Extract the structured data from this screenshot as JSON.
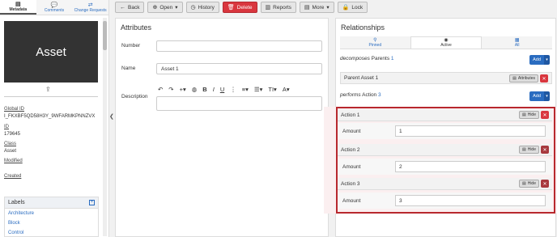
{
  "left": {
    "tabs": [
      {
        "label": "Metadata",
        "icon": "metadata-icon"
      },
      {
        "label": "Comments",
        "icon": "comments-icon"
      },
      {
        "label": "Change Requests",
        "icon": "change-requests-icon"
      }
    ],
    "asset_title": "Asset",
    "global_id_label": "Global ID",
    "global_id_value": "I_FKXBF5QD58H3Y_9WFARMKPNNZVX",
    "id_label": "ID",
    "id_value": "179645",
    "class_label": "Class",
    "class_value": "Asset",
    "modified_label": "Modified",
    "created_label": "Created",
    "labels_title": "Labels",
    "labels": [
      "Architecture",
      "Block",
      "Control"
    ]
  },
  "toolbar": {
    "back": "Back",
    "open": "Open",
    "history": "History",
    "delete": "Delete",
    "reports": "Reports",
    "more": "More",
    "lock": "Lock"
  },
  "attributes": {
    "title": "Attributes",
    "number_label": "Number",
    "number_value": "",
    "name_label": "Name",
    "name_value": "Asset 1",
    "description_label": "Description"
  },
  "relationships": {
    "title": "Relationships",
    "tabs": [
      {
        "label": "Pinned",
        "icon": "pin-icon"
      },
      {
        "label": "Active",
        "icon": "active-icon"
      },
      {
        "label": "All",
        "icon": "all-icon"
      }
    ],
    "group1": {
      "verb": "decomposes",
      "noun": "Parents",
      "count": "1",
      "add": "Add"
    },
    "parent_row": {
      "label": "Parent Asset 1",
      "btn": "Attributes"
    },
    "group2": {
      "verb": "performs",
      "noun": "Action",
      "count": "3",
      "add": "Add"
    },
    "actions": [
      {
        "label": "Action 1",
        "btn": "Hide",
        "amount_label": "Amount",
        "amount": "1"
      },
      {
        "label": "Action 2",
        "btn": "Hide",
        "amount_label": "Amount",
        "amount": "2"
      },
      {
        "label": "Action 3",
        "btn": "Hide",
        "amount_label": "Amount",
        "amount": "3"
      }
    ]
  },
  "colors": {
    "accent": "#2a6cc0",
    "danger": "#d9363e",
    "highlight": "#b8282e"
  }
}
